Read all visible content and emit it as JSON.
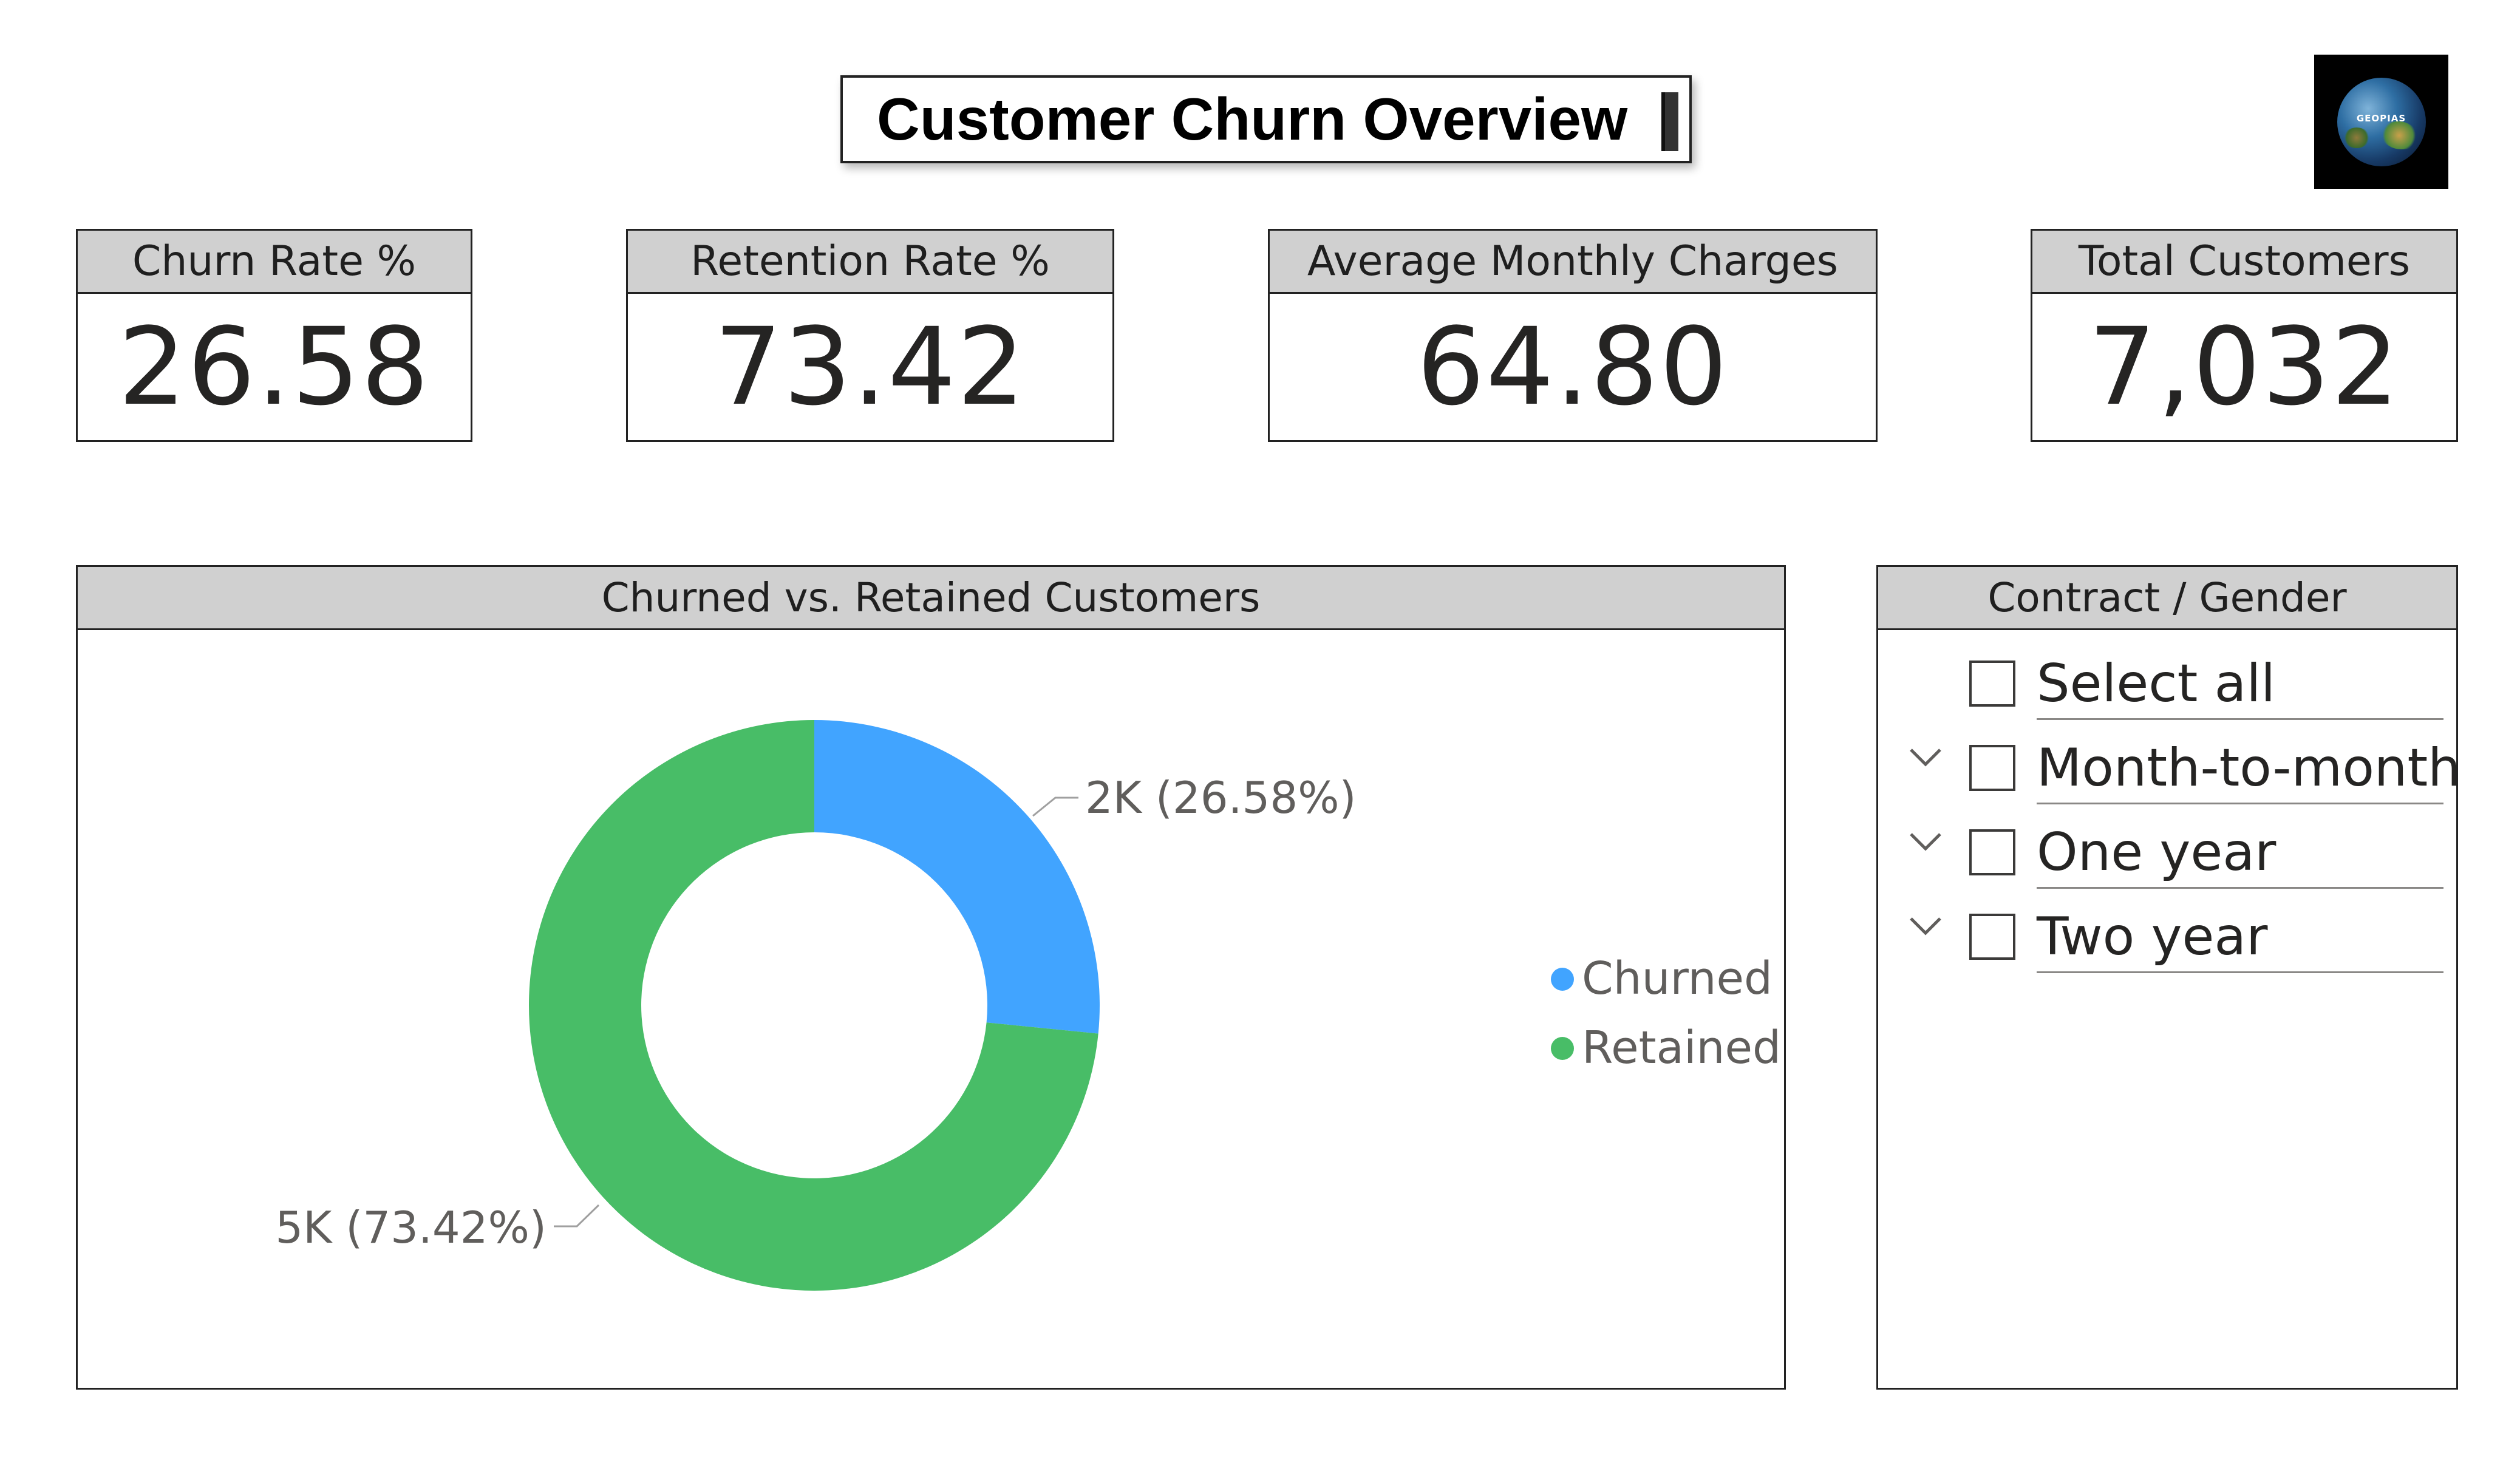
{
  "title": "Customer Churn Overview",
  "logo": {
    "icon": "globe-icon",
    "text": "GEOPIAS"
  },
  "kpis": [
    {
      "label": "Churn Rate %",
      "value": "26.58"
    },
    {
      "label": "Retention Rate %",
      "value": "73.42"
    },
    {
      "label": "Average Monthly Charges",
      "value": "64.80"
    },
    {
      "label": "Total Customers",
      "value": "7,032"
    }
  ],
  "donut": {
    "title": "Churned vs. Retained Customers",
    "label_churned": "2K (26.58%)",
    "label_retained": "5K (73.42%)",
    "legend_churned": "Churned",
    "legend_retained": "Retained"
  },
  "chart_data": {
    "type": "pie",
    "title": "Churned vs. Retained Customers",
    "categories": [
      "Churned",
      "Retained"
    ],
    "values": [
      26.58,
      73.42
    ],
    "data_labels": [
      "2K (26.58%)",
      "5K (73.42%)"
    ],
    "colors": [
      "#41A4FF",
      "#48BD67"
    ],
    "donut": true,
    "legend": "right"
  },
  "slicer": {
    "title": "Contract / Gender",
    "items": [
      {
        "label": "Select all",
        "expandable": false,
        "checked": false
      },
      {
        "label": "Month-to-month",
        "expandable": true,
        "checked": false
      },
      {
        "label": "One year",
        "expandable": true,
        "checked": false
      },
      {
        "label": "Two year",
        "expandable": true,
        "checked": false
      }
    ]
  },
  "colors": {
    "churned": "#41A4FF",
    "retained": "#48BD67",
    "header_bg": "#D0D0D0",
    "border": "#222222"
  }
}
